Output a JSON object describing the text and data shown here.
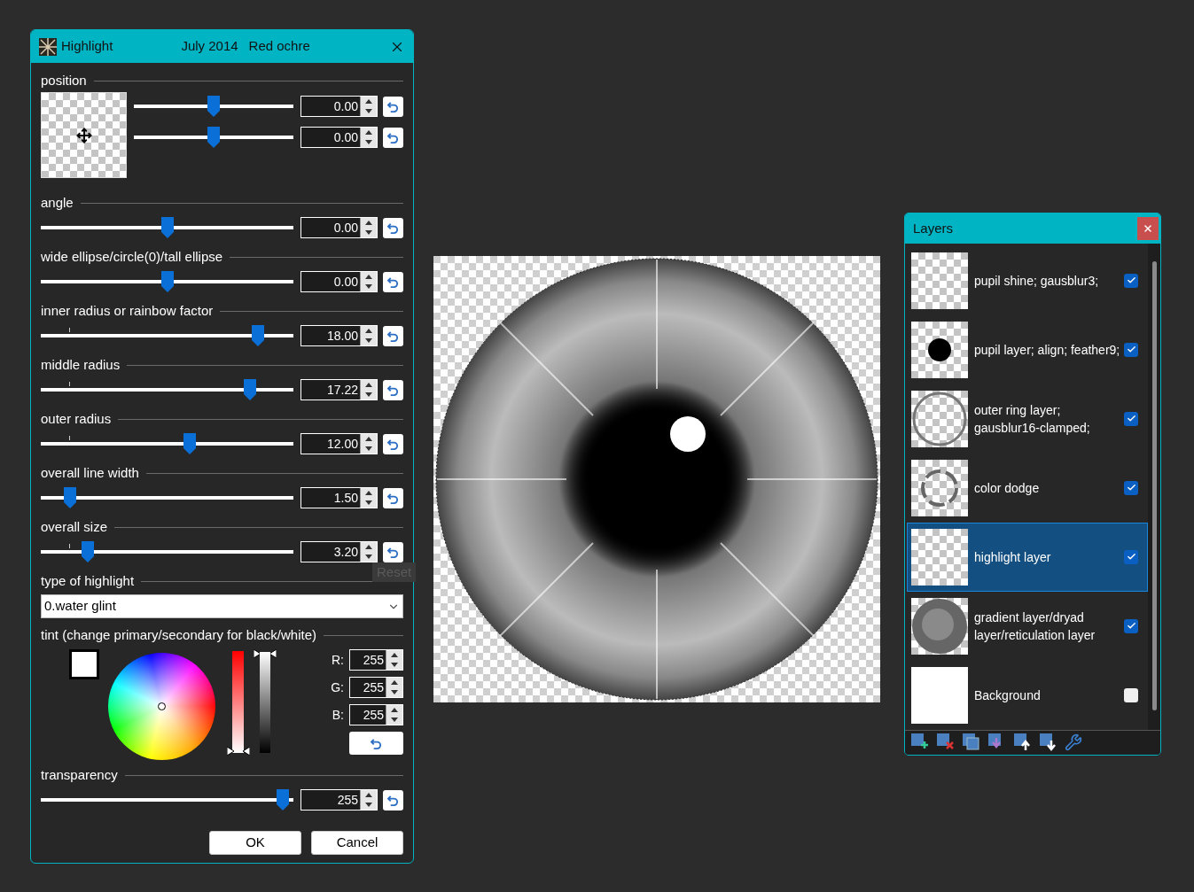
{
  "dialog": {
    "title": "Highlight",
    "date": "July 2014",
    "author": "Red ochre",
    "sections": [
      {
        "label": "position",
        "kind": "position",
        "sliders": [
          {
            "level": 0.5,
            "value": "0.00"
          },
          {
            "level": 0.5,
            "value": "0.00"
          }
        ]
      },
      {
        "label": "angle",
        "kind": "slider",
        "level": 0.5,
        "value": "0.00",
        "tick": false
      },
      {
        "label": "wide ellipse/circle(0)/tall ellipse",
        "kind": "slider",
        "level": 0.5,
        "value": "0.00",
        "tick": false
      },
      {
        "label": "inner radius or rainbow factor",
        "kind": "slider",
        "level": 0.88,
        "value": "18.00",
        "tick": true
      },
      {
        "label": "middle radius",
        "kind": "slider",
        "level": 0.845,
        "value": "17.22",
        "tick": true
      },
      {
        "label": "outer radius",
        "kind": "slider",
        "level": 0.595,
        "value": "12.00",
        "tick": true
      },
      {
        "label": "overall line width",
        "kind": "slider",
        "level": 0.095,
        "value": "1.50"
      },
      {
        "label": "overall size",
        "kind": "slider",
        "level": 0.17,
        "value": "3.20",
        "tick": true
      },
      {
        "label": "type of highlight",
        "kind": "dropdown",
        "value": "0.water glint"
      },
      {
        "label": "tint (change primary/secondary for black/white)",
        "kind": "tint",
        "channels": [
          {
            "label": "R:",
            "value": "255"
          },
          {
            "label": "G:",
            "value": "255"
          },
          {
            "label": "B:",
            "value": "255"
          }
        ]
      },
      {
        "label": "transparency",
        "kind": "slider",
        "level": 0.98,
        "value": "255",
        "tick": false
      }
    ],
    "tooltip": "Reset",
    "buttons": [
      "OK",
      "Cancel"
    ]
  },
  "layers": {
    "title": "Layers",
    "items": [
      {
        "name": "pupil shine; gausblur3;",
        "checked": true,
        "selected": false,
        "kind": "empty"
      },
      {
        "name": "pupil layer; align; feather9;",
        "checked": true,
        "selected": false,
        "kind": "dot"
      },
      {
        "name": "outer ring layer; gausblur16-clamped;",
        "checked": true,
        "selected": false,
        "kind": "ring"
      },
      {
        "name": "color dodge",
        "checked": true,
        "selected": false,
        "kind": "blotch"
      },
      {
        "name": "highlight layer",
        "checked": true,
        "selected": true,
        "kind": "empty"
      },
      {
        "name": "gradient layer/dryad layer/reticulation layer",
        "checked": true,
        "selected": false,
        "kind": "texture"
      },
      {
        "name": "Background",
        "checked": false,
        "selected": false,
        "kind": "white"
      }
    ]
  }
}
